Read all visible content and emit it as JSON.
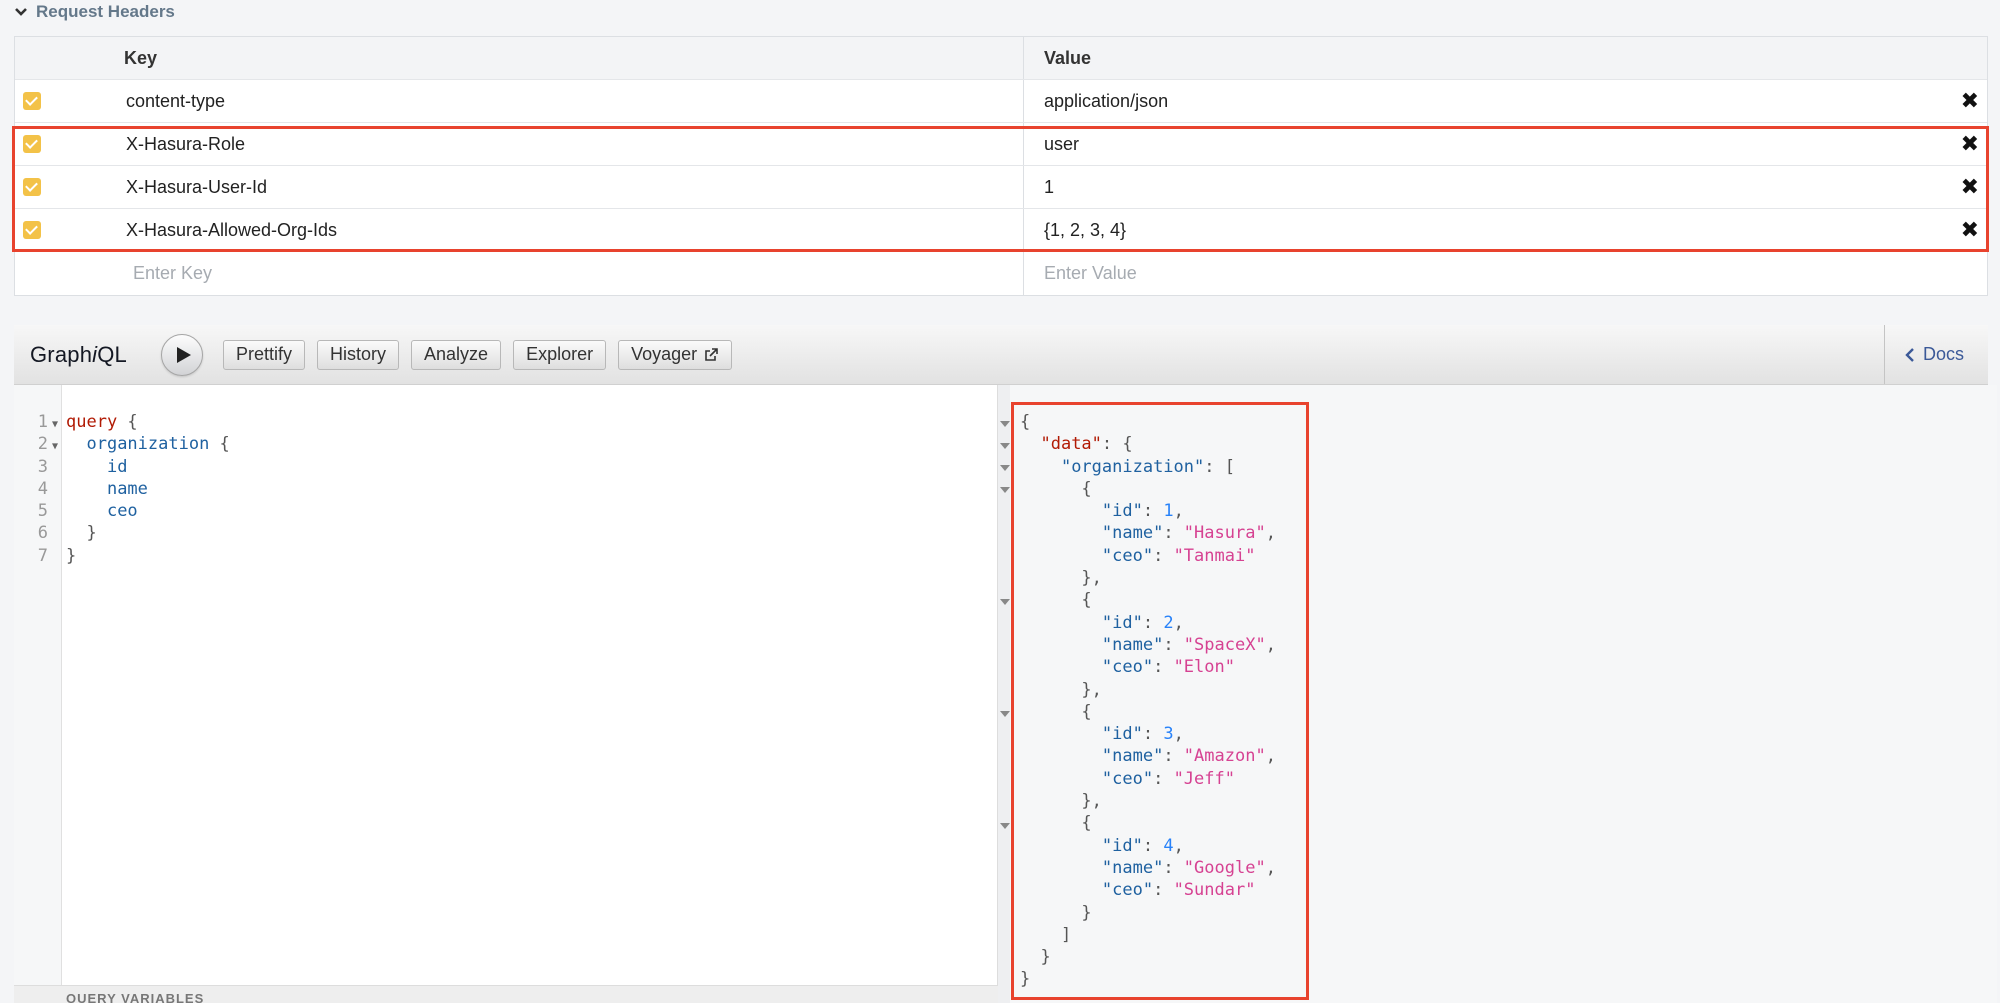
{
  "request_headers": {
    "title": "Request Headers",
    "columns": {
      "key": "Key",
      "value": "Value"
    },
    "rows": [
      {
        "key": "content-type",
        "value": "application/json"
      },
      {
        "key": "X-Hasura-Role",
        "value": "user"
      },
      {
        "key": "X-Hasura-User-Id",
        "value": "1"
      },
      {
        "key": "X-Hasura-Allowed-Org-Ids",
        "value": "{1, 2, 3, 4}"
      }
    ],
    "new_key_placeholder": "Enter Key",
    "new_value_placeholder": "Enter Value"
  },
  "graphiql": {
    "logo_prefix": "Graph",
    "logo_italic": "i",
    "logo_suffix": "QL",
    "buttons": {
      "prettify": "Prettify",
      "history": "History",
      "analyze": "Analyze",
      "explorer": "Explorer",
      "voyager": "Voyager"
    },
    "docs": "Docs",
    "query_variables": "QUERY VARIABLES"
  },
  "query": {
    "line_numbers": [
      "1",
      "2",
      "3",
      "4",
      "5",
      "6",
      "7"
    ],
    "keyword": "query",
    "root_field": "organization",
    "fields": [
      "id",
      "name",
      "ceo"
    ]
  },
  "result": {
    "data_key": "\"data\"",
    "list_key": "\"organization\"",
    "organizations": [
      {
        "id": "1",
        "name": "\"Hasura\"",
        "ceo": "\"Tanmai\""
      },
      {
        "id": "2",
        "name": "\"SpaceX\"",
        "ceo": "\"Elon\""
      },
      {
        "id": "3",
        "name": "\"Amazon\"",
        "ceo": "\"Jeff\""
      },
      {
        "id": "4",
        "name": "\"Google\"",
        "ceo": "\"Sundar\""
      }
    ]
  },
  "colors": {
    "highlight": "#e8432e",
    "checkbox": "#f3c248",
    "docs_link": "#3b5998"
  },
  "icons": [
    "chevron-down-icon",
    "checkbox-checked-icon",
    "remove-x-icon",
    "play-icon",
    "external-link-icon",
    "chevron-left-icon"
  ]
}
